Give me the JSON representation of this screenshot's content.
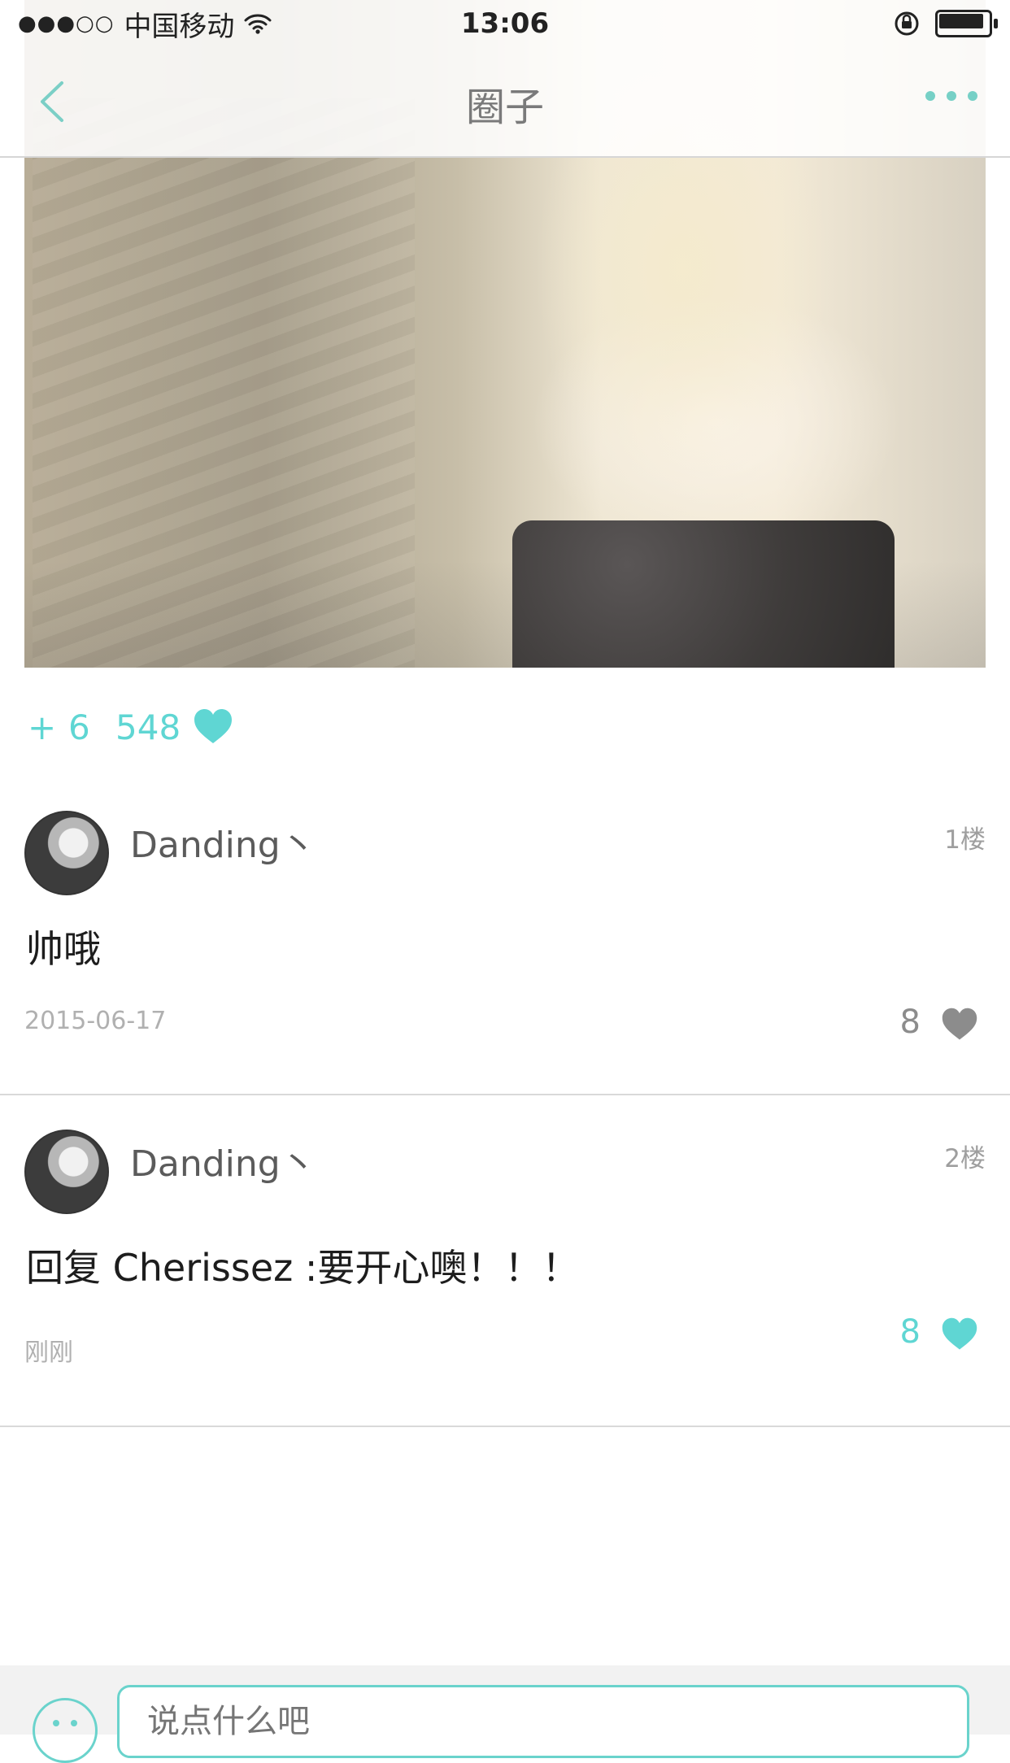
{
  "status_bar": {
    "signal": "●●●○○",
    "carrier": "中国移动",
    "time": "13:06"
  },
  "nav": {
    "title": "圈子"
  },
  "post": {
    "stats": {
      "plus": "+",
      "count": "6",
      "likes": "548"
    }
  },
  "comments": [
    {
      "username": "Danding丶",
      "floor": "1楼",
      "text": "帅哦",
      "date": "2015-06-17",
      "likes": "8",
      "liked": false
    },
    {
      "username": "Danding丶",
      "floor": "2楼",
      "text": "回复 Cherissez :要开心噢！！！",
      "date": "刚刚",
      "likes": "8",
      "liked": true
    }
  ],
  "composer": {
    "placeholder": "说点什么吧"
  },
  "colors": {
    "accent": "#5fd6d3",
    "muted": "#8c8c8c",
    "divider": "#d9d9d9"
  }
}
